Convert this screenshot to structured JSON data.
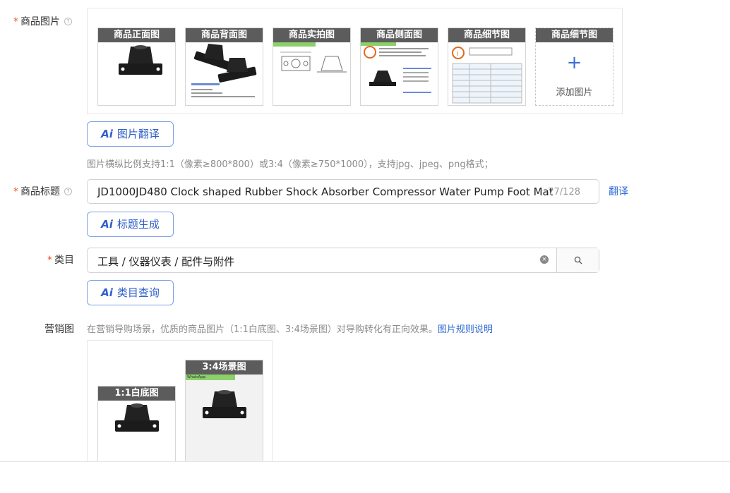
{
  "product_images": {
    "label": "商品图片",
    "help": "?",
    "thumbnails": [
      {
        "caption": "商品正面图"
      },
      {
        "caption": "商品背面图"
      },
      {
        "caption": "商品实拍图"
      },
      {
        "caption": "商品侧面图"
      },
      {
        "caption": "商品细节图"
      }
    ],
    "add_slot": {
      "caption": "商品细节图",
      "plus": "+",
      "label": "添加图片"
    },
    "ai_button": {
      "ai": "Ai",
      "label": "图片翻译"
    },
    "hint": "图片横纵比例支持1:1（像素≥800*800）或3:4（像素≥750*1000），支持jpg、jpeg、png格式；"
  },
  "product_title": {
    "label": "商品标题",
    "help": "?",
    "value": "JD1000JD480 Clock shaped Rubber Shock Absorber Compressor Water Pump Foot Mat",
    "count": "77/128",
    "translate_link": "翻译",
    "ai_button": {
      "ai": "Ai",
      "label": "标题生成"
    }
  },
  "category": {
    "label": "类目",
    "value": "工具 / 仪器仪表 / 配件与附件",
    "clear": "×",
    "ai_button": {
      "ai": "Ai",
      "label": "类目查询"
    }
  },
  "marketing_images": {
    "label": "营销图",
    "hint": "在营销导购场景，优质的商品图片（1:1白底图、3:4场景图）对导购转化有正向效果。",
    "rules_link": "图片规则说明",
    "items": [
      {
        "caption": "1:1白底图"
      },
      {
        "caption": "3:4场景图",
        "tag": "WhatsApp: +8617836910825"
      }
    ]
  },
  "colors": {
    "accent": "#2f6bd2",
    "required": "#e8551e",
    "caption_bg": "#5c5c5c"
  }
}
